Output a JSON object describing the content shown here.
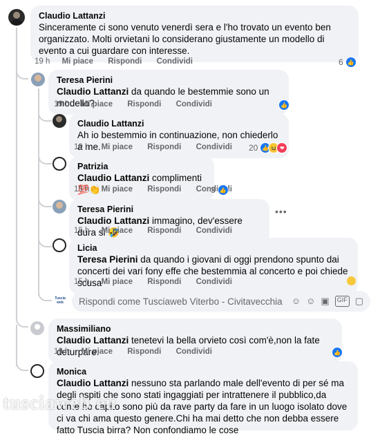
{
  "labels": {
    "like": "Mi piace",
    "reply": "Rispondi",
    "share": "Condividi"
  },
  "comments": [
    {
      "author": "Claudio Lattanzi",
      "text": "Sinceramente ci sono venuto venerdì sera e l'ho trovato un evento ben organizzato. Molti orvietani lo considerano giustamente un modello di evento a cui guardare con interesse.",
      "time": "19 h",
      "reaction_count": "6"
    },
    {
      "author": "Teresa Pierini",
      "tag": "Claudio Lattanzi",
      "text": " da quando le bestemmie sono un modello?",
      "time": "19 h"
    },
    {
      "author": "Claudio Lattanzi",
      "text": "Ah io bestemmio in continuazione, non chiederlo a me.",
      "time": "19 h",
      "reaction_count": "20"
    },
    {
      "author": "Patrizia",
      "tag": "Claudio Lattanzi",
      "text": " complimenti 💯👏",
      "time": "19 h",
      "reaction_count": "3"
    },
    {
      "author": "Teresa Pierini",
      "tag": "Claudio Lattanzi",
      "text": " immagino, dev'essere dura si 🤣",
      "time": "15 h"
    },
    {
      "author": "Licia",
      "tag": "Teresa Pierini",
      "text": " da quando i giovani di oggi prendono spunto dai concerti dei vari fony effe che bestemmia al concerto e poi chiede scusa",
      "time": "15 h"
    },
    {
      "author": "Massimiliano",
      "tag": "Claudio Lattanzi",
      "text": " tenetevi la bella orvieto così com'è,non la fate deturpare.",
      "time": "19 h"
    },
    {
      "author": "Monica",
      "tag": "Claudio Lattanzi",
      "text": " nessuno sta parlando male dell'evento di per sé ma degli ospiti che sono stati ingaggiati per intrattenere il pubblico,da come ho capito sono più da rave party da fare in un luogo isolato dove ci va chi ama questo genere.Chi ha mai detto che non debba essere fatto Tuscia birra? Non confondiamo le cose"
    }
  ],
  "reply_box": {
    "placeholder": "Rispondi come Tusciaweb Viterbo - Civitavecchia",
    "avatar_label": "Tuscia web"
  },
  "watermark": "tusciaweb.eu",
  "colors": {
    "accent": "#1877f2",
    "bubble": "#f0f2f5",
    "muted": "#65676b"
  },
  "icons": [
    "like-icon",
    "haha-icon",
    "love-icon",
    "cry-icon",
    "sticker-icon",
    "emoji-icon",
    "camera-icon",
    "gif-icon",
    "more-icon"
  ]
}
